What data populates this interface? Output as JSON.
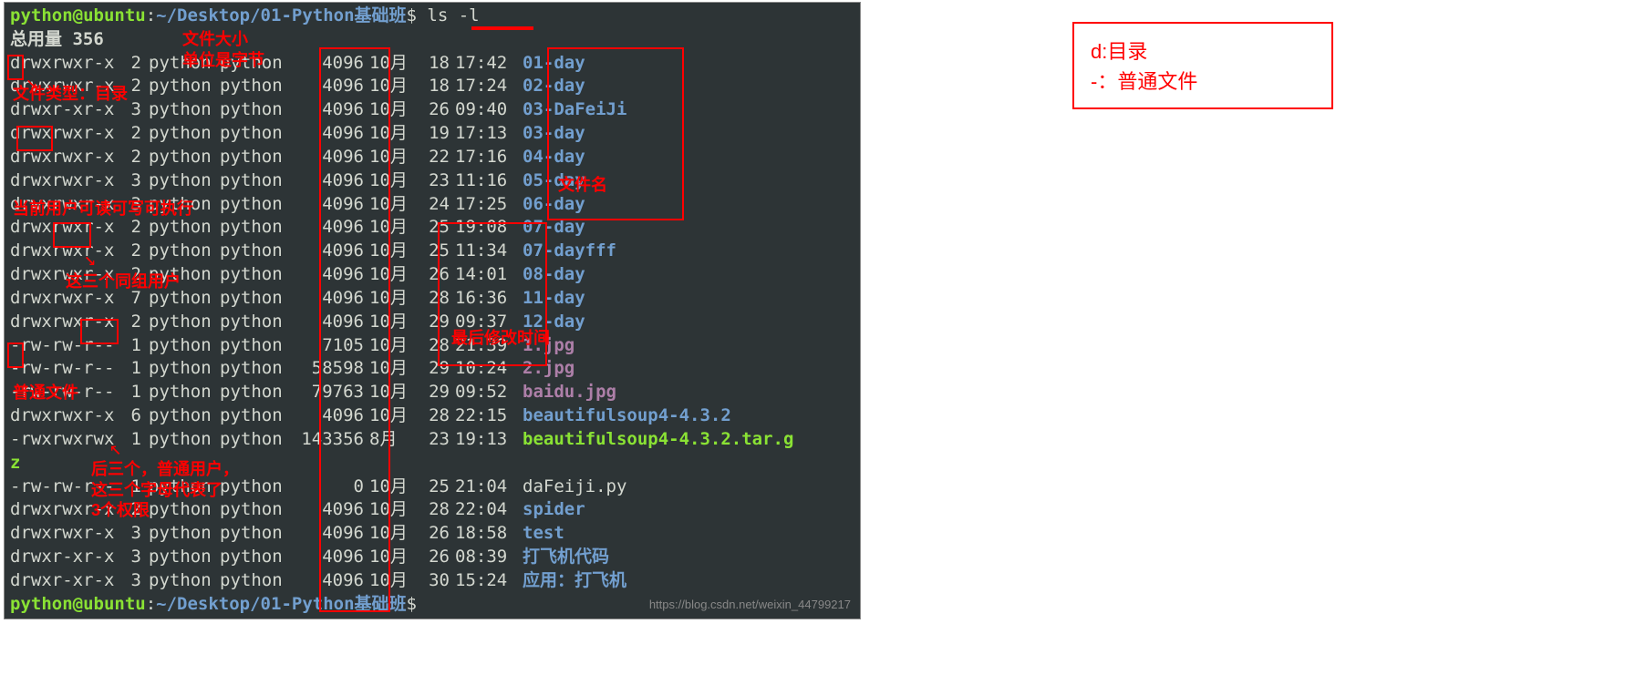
{
  "prompt": {
    "user": "python@ubuntu",
    "colon": ":",
    "path": "~/Desktop/01-Python基础班",
    "dollar": "$",
    "command": "ls -l"
  },
  "total_line": "总用量 356",
  "rows": [
    {
      "perm": "drwxrwxr-x",
      "links": "2",
      "owner": "python",
      "group": "python",
      "size": "4096",
      "month": "10月",
      "day": "18",
      "time": "17:42",
      "name": "01-day",
      "cls": "name-dir"
    },
    {
      "perm": "drwxrwxr-x",
      "links": "2",
      "owner": "python",
      "group": "python",
      "size": "4096",
      "month": "10月",
      "day": "18",
      "time": "17:24",
      "name": "02-day",
      "cls": "name-dir"
    },
    {
      "perm": "drwxr-xr-x",
      "links": "3",
      "owner": "python",
      "group": "python",
      "size": "4096",
      "month": "10月",
      "day": "26",
      "time": "09:40",
      "name": "03-DaFeiJi",
      "cls": "name-dir"
    },
    {
      "perm": "drwxrwxr-x",
      "links": "2",
      "owner": "python",
      "group": "python",
      "size": "4096",
      "month": "10月",
      "day": "19",
      "time": "17:13",
      "name": "03-day",
      "cls": "name-dir"
    },
    {
      "perm": "drwxrwxr-x",
      "links": "2",
      "owner": "python",
      "group": "python",
      "size": "4096",
      "month": "10月",
      "day": "22",
      "time": "17:16",
      "name": "04-day",
      "cls": "name-dir"
    },
    {
      "perm": "drwxrwxr-x",
      "links": "3",
      "owner": "python",
      "group": "python",
      "size": "4096",
      "month": "10月",
      "day": "23",
      "time": "11:16",
      "name": "05-day",
      "cls": "name-dir"
    },
    {
      "perm": "drwxrwxr-x",
      "links": "3",
      "owner": "python",
      "group": "python",
      "size": "4096",
      "month": "10月",
      "day": "24",
      "time": "17:25",
      "name": "06-day",
      "cls": "name-dir"
    },
    {
      "perm": "drwxrwxr-x",
      "links": "2",
      "owner": "python",
      "group": "python",
      "size": "4096",
      "month": "10月",
      "day": "25",
      "time": "19:08",
      "name": "07-day",
      "cls": "name-dir"
    },
    {
      "perm": "drwxrwxr-x",
      "links": "2",
      "owner": "python",
      "group": "python",
      "size": "4096",
      "month": "10月",
      "day": "25",
      "time": "11:34",
      "name": "07-dayfff",
      "cls": "name-dir"
    },
    {
      "perm": "drwxrwxr-x",
      "links": "2",
      "owner": "python",
      "group": "python",
      "size": "4096",
      "month": "10月",
      "day": "26",
      "time": "14:01",
      "name": "08-day",
      "cls": "name-dir"
    },
    {
      "perm": "drwxrwxr-x",
      "links": "7",
      "owner": "python",
      "group": "python",
      "size": "4096",
      "month": "10月",
      "day": "28",
      "time": "16:36",
      "name": "11-day",
      "cls": "name-dir"
    },
    {
      "perm": "drwxrwxr-x",
      "links": "2",
      "owner": "python",
      "group": "python",
      "size": "4096",
      "month": "10月",
      "day": "29",
      "time": "09:37",
      "name": "12-day",
      "cls": "name-dir"
    },
    {
      "perm": "-rw-rw-r--",
      "links": "1",
      "owner": "python",
      "group": "python",
      "size": "7105",
      "month": "10月",
      "day": "28",
      "time": "21:39",
      "name": "1.jpg",
      "cls": "name-file"
    },
    {
      "perm": "-rw-rw-r--",
      "links": "1",
      "owner": "python",
      "group": "python",
      "size": "58598",
      "month": "10月",
      "day": "29",
      "time": "10:24",
      "name": "2.jpg",
      "cls": "name-file"
    },
    {
      "perm": "-rw-rw-r--",
      "links": "1",
      "owner": "python",
      "group": "python",
      "size": "79763",
      "month": "10月",
      "day": "29",
      "time": "09:52",
      "name": "baidu.jpg",
      "cls": "name-file"
    },
    {
      "perm": "drwxrwxr-x",
      "links": "6",
      "owner": "python",
      "group": "python",
      "size": "4096",
      "month": "10月",
      "day": "28",
      "time": "22:15",
      "name": "beautifulsoup4-4.3.2",
      "cls": "name-dir"
    },
    {
      "perm": "-rwxrwxrwx",
      "links": "1",
      "owner": "python",
      "group": "python",
      "size": "143356",
      "month": "8月",
      "day": "23",
      "time": "19:13",
      "name": "beautifulsoup4-4.3.2.tar.g",
      "cls": "name-exec"
    }
  ],
  "wrap_line": "z",
  "rows2": [
    {
      "perm": "-rw-rw-r--",
      "links": "1",
      "owner": "python",
      "group": "python",
      "size": "0",
      "month": "10月",
      "day": "25",
      "time": "21:04",
      "name": "daFeiji.py",
      "cls": "name-plain"
    },
    {
      "perm": "drwxrwxr-x",
      "links": "2",
      "owner": "python",
      "group": "python",
      "size": "4096",
      "month": "10月",
      "day": "28",
      "time": "22:04",
      "name": "spider",
      "cls": "name-dir"
    },
    {
      "perm": "drwxrwxr-x",
      "links": "3",
      "owner": "python",
      "group": "python",
      "size": "4096",
      "month": "10月",
      "day": "26",
      "time": "18:58",
      "name": "test",
      "cls": "name-dir"
    },
    {
      "perm": "drwxr-xr-x",
      "links": "3",
      "owner": "python",
      "group": "python",
      "size": "4096",
      "month": "10月",
      "day": "26",
      "time": "08:39",
      "name": "打飞机代码",
      "cls": "name-dir"
    },
    {
      "perm": "drwxr-xr-x",
      "links": "3",
      "owner": "python",
      "group": "python",
      "size": "4096",
      "month": "10月",
      "day": "30",
      "time": "15:24",
      "name": "应用：打飞机",
      "cls": "name-dir"
    }
  ],
  "watermark": "https://blog.csdn.net/weixin_44799217",
  "annotations": {
    "filesize_label_1": "文件大小",
    "filesize_label_2": "单位是字节",
    "filetype_label": "文件类型：目录",
    "curuser_label": "当前用户可读可写可执行",
    "group_label": "这三个同组用户",
    "other_label_1": "后三个，普通用户，",
    "other_label_2": "这三个字母代表了",
    "other_label_3": "3个权限",
    "plainfile_label": "普通文件",
    "filename_label": "文件名",
    "mtime_label": "最后修改时间"
  },
  "legend": {
    "line1": "d:目录",
    "line2": "-：普通文件"
  }
}
